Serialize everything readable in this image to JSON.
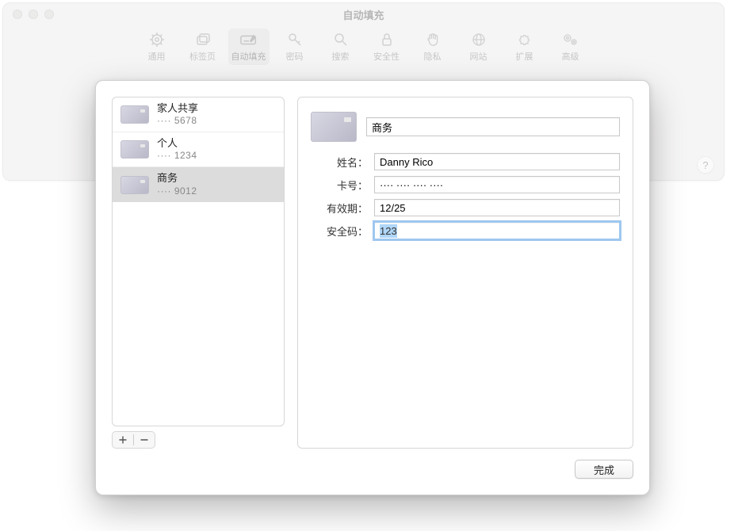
{
  "window": {
    "title": "自动填充"
  },
  "toolbar": {
    "items": [
      {
        "label": "通用",
        "name": "general"
      },
      {
        "label": "标签页",
        "name": "tabs"
      },
      {
        "label": "自动填充",
        "name": "autofill",
        "selected": true
      },
      {
        "label": "密码",
        "name": "passwords"
      },
      {
        "label": "搜索",
        "name": "search"
      },
      {
        "label": "安全性",
        "name": "security"
      },
      {
        "label": "隐私",
        "name": "privacy"
      },
      {
        "label": "网站",
        "name": "websites"
      },
      {
        "label": "扩展",
        "name": "extensions"
      },
      {
        "label": "高级",
        "name": "advanced"
      }
    ]
  },
  "help": "?",
  "cards": [
    {
      "name": "家人共享",
      "last4": "···· 5678"
    },
    {
      "name": "个人",
      "last4": "···· 1234"
    },
    {
      "name": "商务",
      "last4": "···· 9012",
      "selected": true
    }
  ],
  "detail": {
    "title": "商务",
    "labels": {
      "name": "姓名：",
      "number": "卡号：",
      "expiry": "有效期：",
      "cvv": "安全码："
    },
    "values": {
      "name": "Danny Rico",
      "number": "···· ···· ···· ····",
      "expiry": "12/25",
      "cvv": "123"
    }
  },
  "buttons": {
    "add": "+",
    "remove": "−",
    "done": "完成"
  }
}
